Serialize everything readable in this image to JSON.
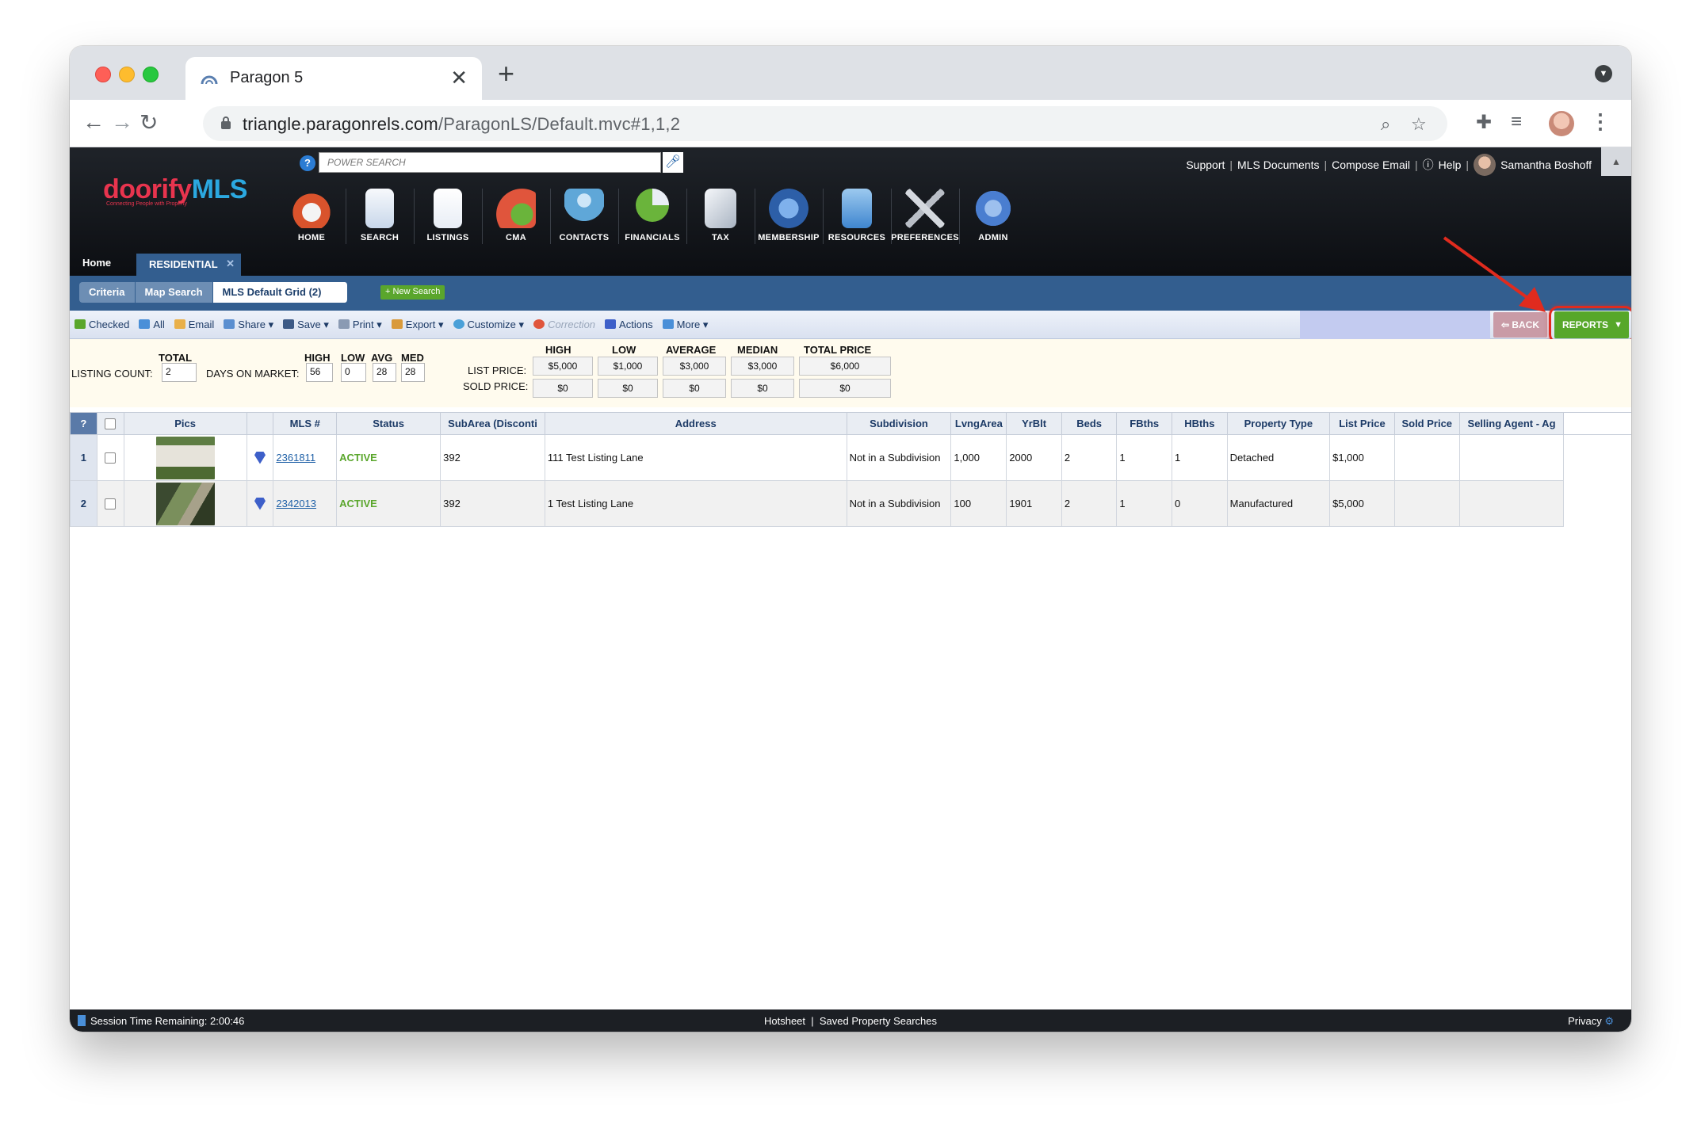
{
  "browser": {
    "tab_title": "Paragon 5",
    "url_domain": "triangle.paragonrels.com",
    "url_path": "/ParagonLS/Default.mvc#1,1,2",
    "tab_close": "✕",
    "new_tab": "+"
  },
  "app": {
    "logo_doorify": "doorify",
    "logo_mls": "MLS",
    "logo_tagline": "Connecting People with Property",
    "power_search_placeholder": "POWER SEARCH",
    "top_links": [
      "Support",
      "MLS Documents",
      "Compose Email",
      "Help"
    ],
    "user_name": "Samantha Boshoff",
    "nav": [
      {
        "label": "HOME",
        "icon": "home-icon",
        "color": "#d9532c"
      },
      {
        "label": "SEARCH",
        "icon": "search-icon",
        "color": "#c8d7ea"
      },
      {
        "label": "LISTINGS",
        "icon": "listings-icon",
        "color": "#e8edf5"
      },
      {
        "label": "CMA",
        "icon": "cma-icon",
        "color": "#e0553c"
      },
      {
        "label": "CONTACTS",
        "icon": "contacts-icon",
        "color": "#5fa7d8"
      },
      {
        "label": "FINANCIALS",
        "icon": "financials-icon",
        "color": "#6ab43b"
      },
      {
        "label": "TAX",
        "icon": "tax-icon",
        "color": "#cfd6df"
      },
      {
        "label": "MEMBERSHIP",
        "icon": "membership-icon",
        "color": "#3a78c8"
      },
      {
        "label": "RESOURCES",
        "icon": "resources-icon",
        "color": "#6aa6dd"
      },
      {
        "label": "PREFERENCES",
        "icon": "preferences-icon",
        "color": "#c9ced6"
      },
      {
        "label": "ADMIN",
        "icon": "admin-icon",
        "color": "#4a7ed0"
      }
    ],
    "home_tab": "Home",
    "residential_tab": "RESIDENTIAL",
    "tab_close": "✕",
    "subtabs": [
      "Criteria",
      "Map Search",
      "MLS Default Grid (2)"
    ],
    "new_search": "+ New Search",
    "actions": [
      "Checked",
      "All",
      "Email",
      "Share",
      "Save",
      "Print",
      "Export",
      "Customize",
      "Correction",
      "Actions",
      "More"
    ],
    "back_label": "BACK",
    "reports_label": "REPORTS"
  },
  "stats": {
    "total_header": "TOTAL",
    "listing_count_label": "LISTING COUNT:",
    "listing_count": "2",
    "dom_label": "DAYS ON MARKET:",
    "dom_headers": [
      "HIGH",
      "LOW",
      "AVG",
      "MED"
    ],
    "dom_values": [
      "56",
      "0",
      "28",
      "28"
    ],
    "price_headers": [
      "HIGH",
      "LOW",
      "AVERAGE",
      "MEDIAN",
      "TOTAL PRICE"
    ],
    "list_price_label": "LIST PRICE:",
    "sold_price_label": "SOLD PRICE:",
    "list_prices": [
      "$5,000",
      "$1,000",
      "$3,000",
      "$3,000",
      "$6,000"
    ],
    "sold_prices": [
      "$0",
      "$0",
      "$0",
      "$0",
      "$0"
    ]
  },
  "grid": {
    "help": "?",
    "columns": [
      "Pics",
      "MLS #",
      "Status",
      "SubArea (Disconti",
      "Address",
      "Subdivision",
      "LvngArea",
      "YrBlt",
      "Beds",
      "FBths",
      "HBths",
      "Property Type",
      "List Price",
      "Sold Price",
      "Selling Agent - Ag"
    ],
    "rows": [
      {
        "n": "1",
        "mls": "2361811",
        "status": "ACTIVE",
        "subarea": "392",
        "address": "111 Test Listing Lane",
        "subdivision": "Not in a Subdivision",
        "area": "1,000",
        "yrblt": "2000",
        "beds": "2",
        "fbths": "1",
        "hbths": "1",
        "type": "Detached",
        "list": "$1,000",
        "sold": "",
        "agent": ""
      },
      {
        "n": "2",
        "mls": "2342013",
        "status": "ACTIVE",
        "subarea": "392",
        "address": "1 Test Listing Lane",
        "subdivision": "Not in a Subdivision",
        "area": "100",
        "yrblt": "1901",
        "beds": "2",
        "fbths": "1",
        "hbths": "0",
        "type": "Manufactured",
        "list": "$5,000",
        "sold": "",
        "agent": ""
      }
    ]
  },
  "footer": {
    "session": "Session Time Remaining: 2:00:46",
    "hotsheet": "Hotsheet",
    "saved": "Saved Property Searches",
    "privacy": "Privacy"
  }
}
